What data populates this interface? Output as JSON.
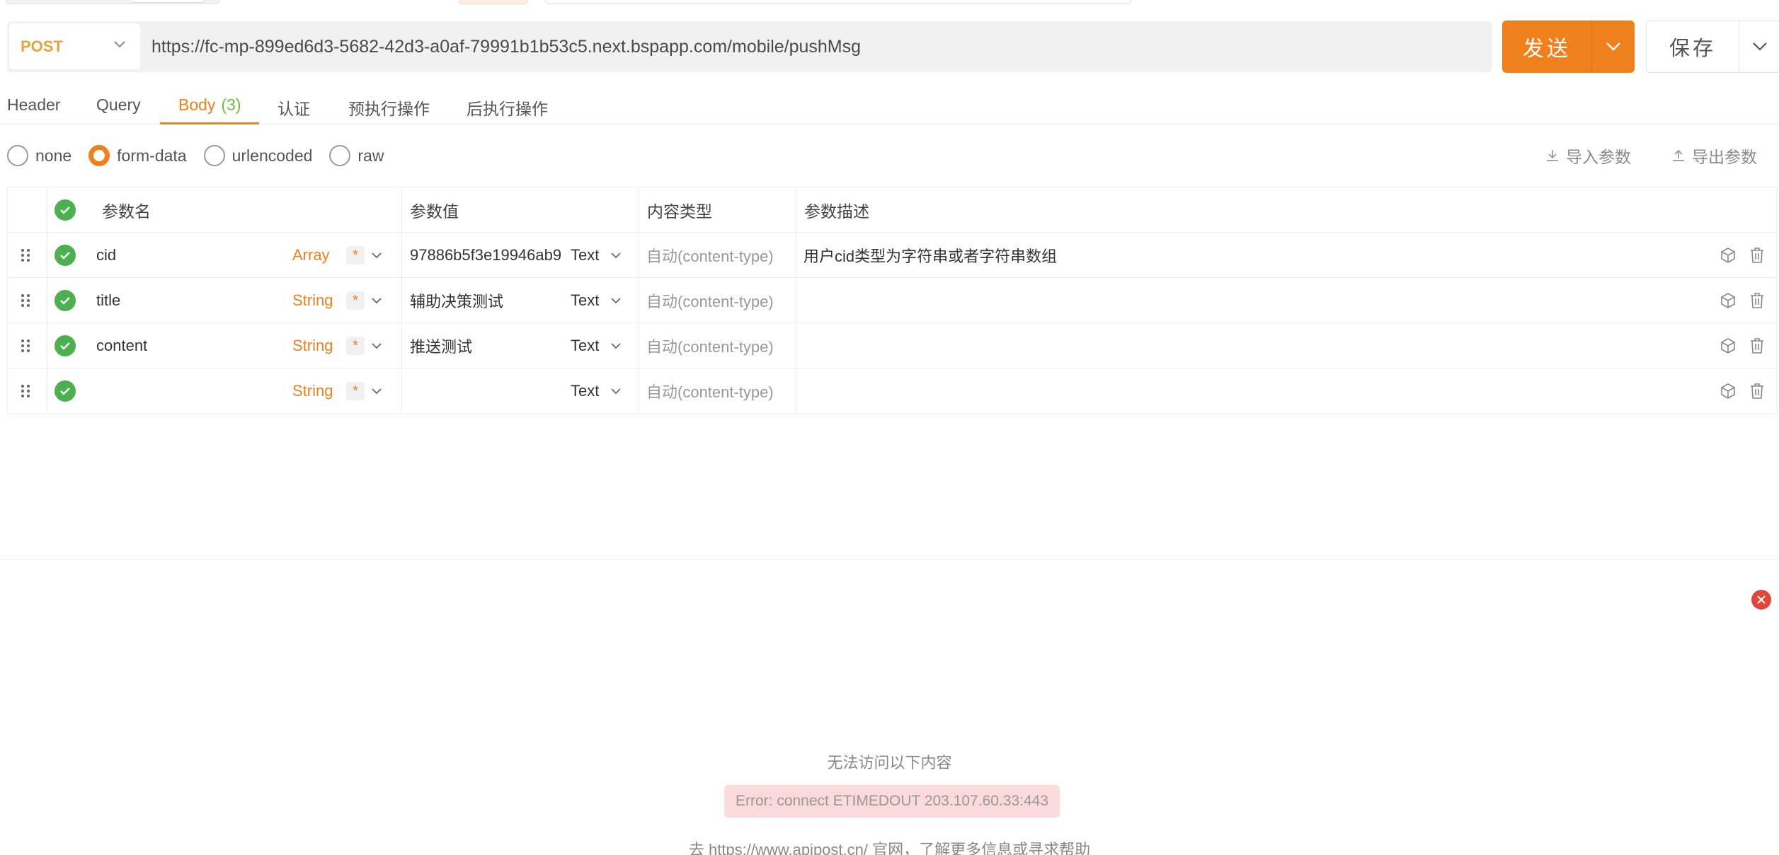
{
  "request": {
    "method": "POST",
    "url": "https://fc-mp-899ed6d3-5682-42d3-a0af-79991b1b53c5.next.bspapp.com/mobile/pushMsg",
    "send_label": "发送",
    "save_label": "保存"
  },
  "tabs": [
    {
      "label": "Header"
    },
    {
      "label": "Query"
    },
    {
      "label": "Body",
      "count": "(3)"
    },
    {
      "label": "认证"
    },
    {
      "label": "预执行操作"
    },
    {
      "label": "后执行操作"
    }
  ],
  "body_types": [
    "none",
    "form-data",
    "urlencoded",
    "raw"
  ],
  "selected_body_type": "form-data",
  "actions": {
    "import": "导入参数",
    "export": "导出参数"
  },
  "table": {
    "headers": {
      "name": "参数名",
      "value": "参数值",
      "content_type": "内容类型",
      "description": "参数描述"
    },
    "rows": [
      {
        "name": "cid",
        "type": "Array",
        "required": "*",
        "value": "97886b5f3e19946ab9",
        "value_type": "Text",
        "content_type": "自动(content-type)",
        "description": "用户cid类型为字符串或者字符串数组"
      },
      {
        "name": "title",
        "type": "String",
        "required": "*",
        "value": "辅助决策测试",
        "value_type": "Text",
        "content_type": "自动(content-type)",
        "description": ""
      },
      {
        "name": "content",
        "type": "String",
        "required": "*",
        "value": "推送测试",
        "value_type": "Text",
        "content_type": "自动(content-type)",
        "description": ""
      },
      {
        "name": "",
        "type": "String",
        "required": "*",
        "value": "",
        "value_type": "Text",
        "content_type": "自动(content-type)",
        "description": ""
      }
    ]
  },
  "response": {
    "title": "无法访问以下内容",
    "error": "Error: connect ETIMEDOUT 203.107.60.33:443",
    "help": "去 https://www.apipost.cn/ 官网，了解更多信息或寻求帮助"
  },
  "colors": {
    "accent": "#f0801c",
    "success": "#4caf50",
    "error": "#e0463c",
    "method": "#e6a23c"
  }
}
